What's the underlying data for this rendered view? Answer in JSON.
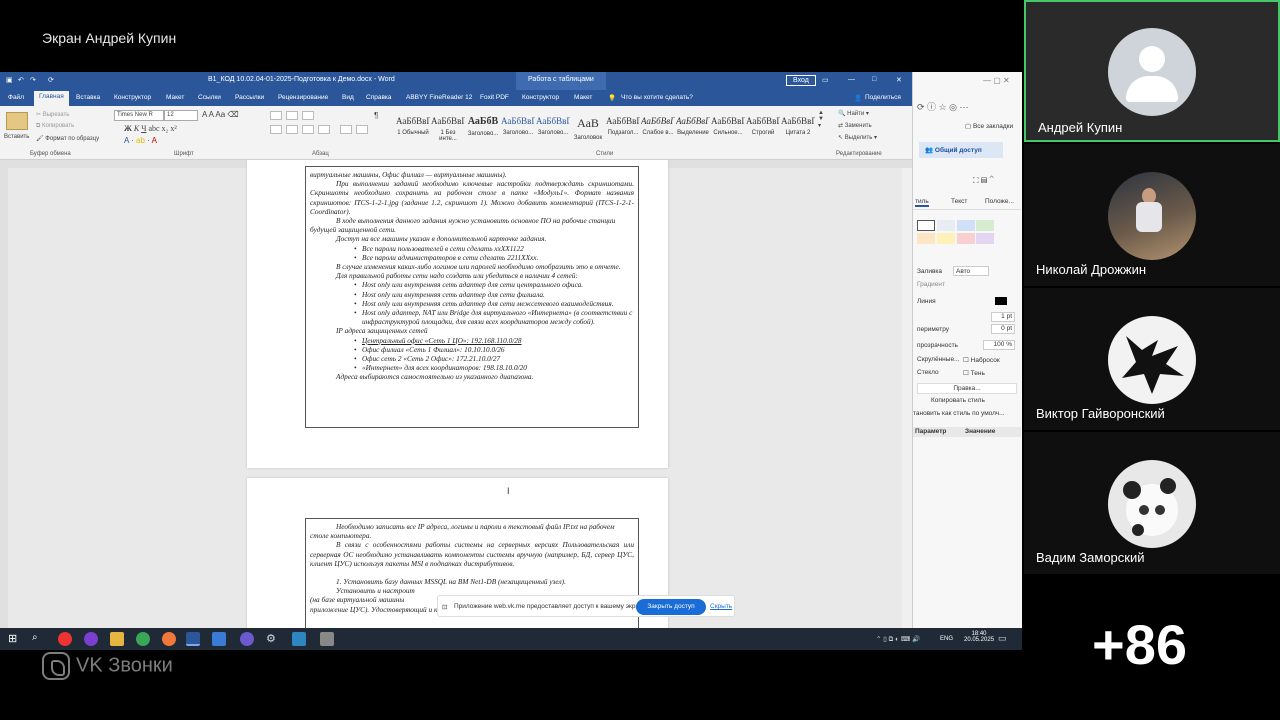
{
  "share": {
    "title": "Экран Андрей Купин"
  },
  "word": {
    "window_title": "В1_КОД 10.02.04-01-2025-Подготовка к Демо.docx  -  Word",
    "context_label": "Работа с таблицами",
    "login_label": "Вход",
    "tabs": [
      "Файл",
      "Главная",
      "Вставка",
      "Конструктор",
      "Макет",
      "Ссылки",
      "Рассылки",
      "Рецензирование",
      "Вид",
      "Справка",
      "ABBYY FineReader 12",
      "Foxit PDF",
      "Конструктор",
      "Макет"
    ],
    "tell_me": "Что вы хотите сделать?",
    "share_btn": "Поделиться",
    "clipboard": {
      "paste": "Вставить",
      "cut": "Вырезать",
      "copy": "Копировать",
      "format": "Формат по образцу",
      "label": "Буфер обмена"
    },
    "font": {
      "name": "Times New R",
      "size": "12",
      "label": "Шрифт"
    },
    "paragraph_label": "Абзац",
    "styles_label": "Стили",
    "styles": [
      {
        "preview": "АаБбВвГг",
        "name": "1 Обычный"
      },
      {
        "preview": "АаБбВвГг",
        "name": "1 Без инте..."
      },
      {
        "preview": "АаБбВ",
        "name": "Заголово..."
      },
      {
        "preview": "АаБбВвГ",
        "name": "Заголово..."
      },
      {
        "preview": "АаБбВвГг",
        "name": "Заголово..."
      },
      {
        "preview": "АаВ",
        "name": "Заголовок"
      },
      {
        "preview": "АаБбВвГ",
        "name": "Подзагол..."
      },
      {
        "preview": "АаБбВвГг",
        "name": "Слабое в..."
      },
      {
        "preview": "АаБбВвГг",
        "name": "Выделение"
      },
      {
        "preview": "АаБбВвГг",
        "name": "Сильное..."
      },
      {
        "preview": "АаБбВвГг",
        "name": "Строгий"
      },
      {
        "preview": "АаБбВвГг",
        "name": "Цитата 2"
      }
    ],
    "editing": {
      "find": "Найти",
      "replace": "Заменить",
      "select": "Выделить",
      "label": "Редактирование"
    },
    "page1_lines": [
      "виртуальные машины, Офис филиал — виртуальные машины).",
      "При выполнении заданий необходимо ключевые настройки подтверждать скриншотами. Скриншоты необходимо сохранить на рабочем столе в папке «Модуль1». Формат названия скриншотов: ITCS-1-2-1.jpg (задание 1.2, скриншот 1). Можно добавить комментарий (ITCS-1-2-1-Coordinator).",
      "В ходе выполнения данного задания нужно установить основное ПО на рабочие станции будущей защищенной сети.",
      "Доступ на все машины указан в дополнительной карточке задания.",
      "Все пароли пользователей в сети сделать xxXX1122",
      "Все пароли администраторов в сети сделать 2211XXxx.",
      "В случае изменения каких-либо логинов или паролей необходимо отобразить это в отчете.",
      "Для правильной работы сети надо создать или убедиться в наличии 4 сетей:",
      "Host only или внутренняя сеть адаптер для сети центрального офиса.",
      "Host only или внутренняя сеть адаптер для сети филиала.",
      "Host only или внутренняя сеть адаптер для сети межсетевого взаимодействия.",
      "Host only адаптер, NAT или Bridge для виртуального «Интернета» (в соответствии с инфраструктурой площадки, для связи всех координаторов между собой).",
      "IP адреса защищенных сетей",
      "Центральный офис «Сеть 1 ЦО»: 192.168.110.0/28",
      "Офис филиал «Сеть 1 Филиал»: 10.10.10.0/26",
      "Офис сеть 2 «Сеть 2 Офис»: 172.21.10.0/27",
      "«Интернет» для всех координаторов: 198.18.10.0/20",
      "Адреса выбираются самостоятельно из указанного диапазона."
    ],
    "page2_lines": [
      "Необходимо записать все IP адреса, логины и пароли в текстовый файл IP.txt на рабочем столе компьютера.",
      "В связи с особенностями работы системы на серверных версиях Пользовательская или серверная ОС необходимо устанавливать компоненты системы вручную (например, БД, сервер ЦУС, клиент ЦУС) используя пакеты MSI в подпапках дистрибутивов.",
      "1. Установить базу данных MSSQL на BM Net1-DB (незащищенный узел).",
      "Установить и настроит",
      "(на базе виртуальной машины",
      "приложение ЦУС). Удостоверяющий и ключевой центр"
    ]
  },
  "office_pane": {
    "bookmarks": "Все закладки",
    "share_access": "Общий доступ",
    "tabs": [
      "тиль",
      "Текст",
      "Положе..."
    ],
    "fill_label": "Заливка",
    "fill_value": "Авто",
    "gradient": "Градиент",
    "line": "Линия",
    "pt1": "1 pt",
    "perimeter": "периметру",
    "pt0": "0 pt",
    "transparency": "прозрачность",
    "transparency_value": "100 %",
    "hidden": "Скрулённые...",
    "shadow_set": "Набросок",
    "glass": "Стекло",
    "shadow": "Тень",
    "rules": "Правка...",
    "copy_style": "Копировать стиль",
    "set_default": "тановить как стиль по умолч...",
    "param": "Параметр",
    "value": "Значение"
  },
  "notification": {
    "text": "Приложение web.vk.me предоставляет доступ к вашему экрану",
    "stop": "Закрыть доступ",
    "hide": "Скрыть"
  },
  "taskbar": {
    "lang": "ENG",
    "time": "18:40",
    "date": "20.05.2025"
  },
  "branding": {
    "vk": "VK Звонки"
  },
  "participants": [
    {
      "name": "Андрей Купин",
      "active": true
    },
    {
      "name": "Николай Дрожжин",
      "active": false
    },
    {
      "name": "Виктор Гайворонский",
      "active": false
    },
    {
      "name": "Вадим Заморский",
      "active": false
    }
  ],
  "more_count": "+86",
  "colors": {
    "word_blue": "#2b579a",
    "accent_green": "#46c86a",
    "vk_button": "#1a6cd6"
  }
}
